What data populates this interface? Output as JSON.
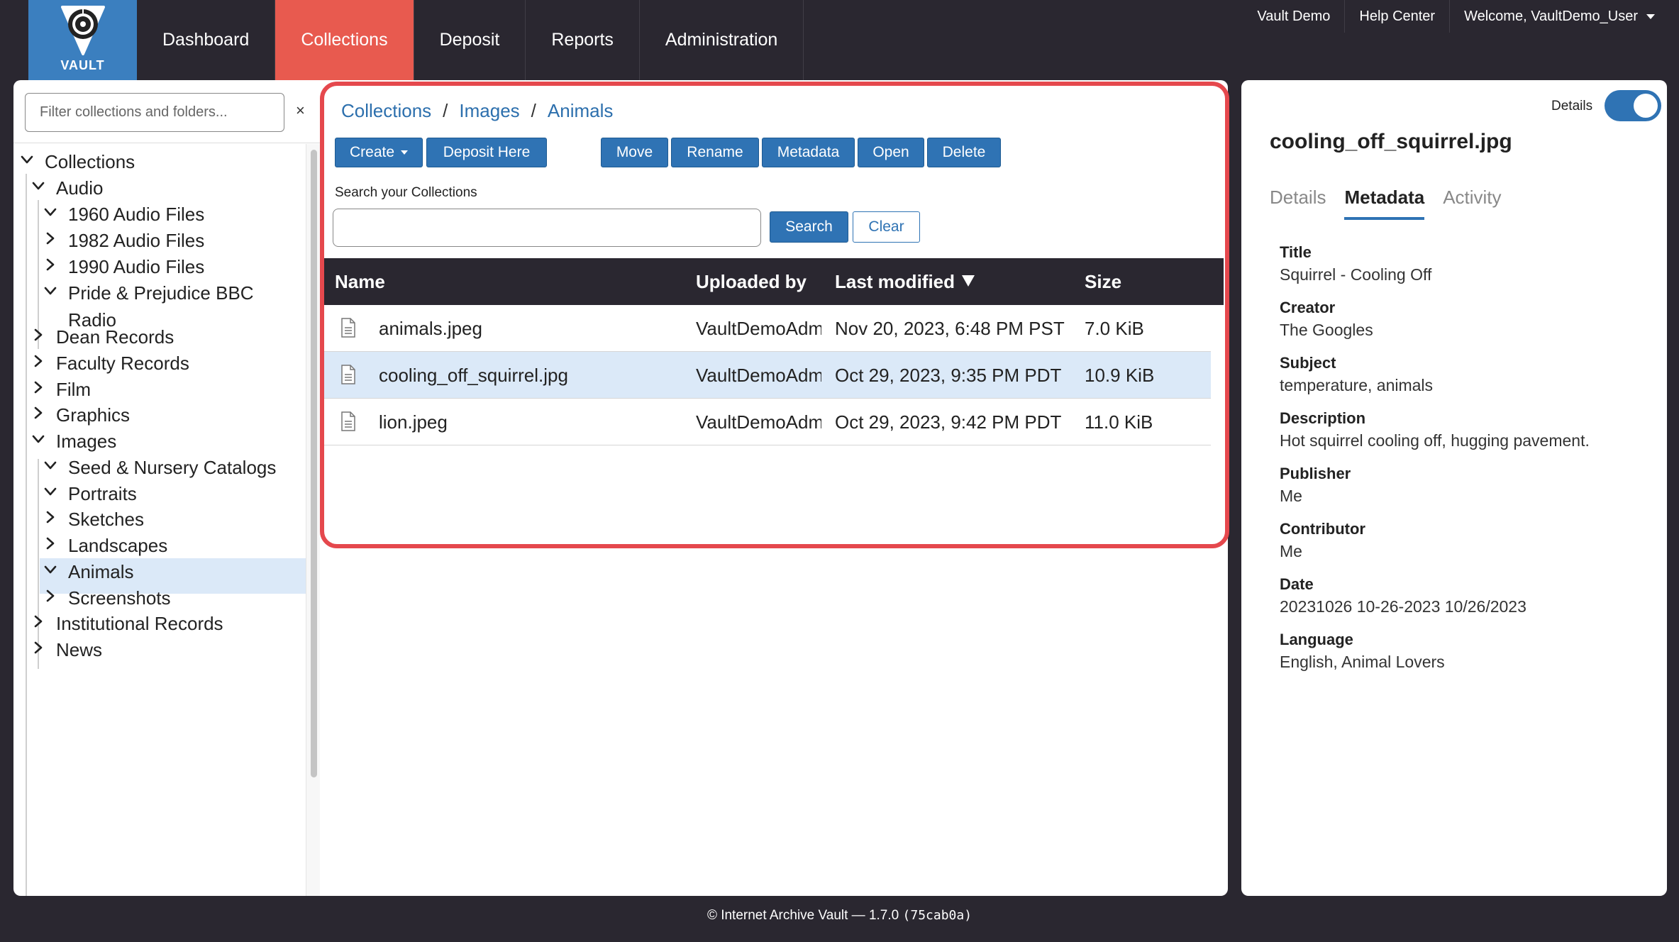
{
  "brand": {
    "logo_text": "VAULT"
  },
  "nav": {
    "items": [
      {
        "label": "Dashboard",
        "active": false
      },
      {
        "label": "Collections",
        "active": true
      },
      {
        "label": "Deposit",
        "active": false
      },
      {
        "label": "Reports",
        "active": false
      },
      {
        "label": "Administration",
        "active": false
      }
    ]
  },
  "utility": {
    "vault_demo": "Vault Demo",
    "help_center": "Help Center",
    "welcome": "Welcome, VaultDemo_User"
  },
  "sidebar": {
    "filter_placeholder": "Filter collections and folders...",
    "filter_clear": "×",
    "tree": [
      {
        "label": "Collections",
        "expanded": true
      },
      {
        "label": "Audio",
        "expanded": true
      },
      {
        "label": "1960 Audio Files",
        "expanded": true
      },
      {
        "label": "1982 Audio Files",
        "expanded": false
      },
      {
        "label": "1990 Audio Files",
        "expanded": false
      },
      {
        "label": "Pride & Prejudice BBC",
        "label2": "Radio",
        "expanded": true
      },
      {
        "label": "Dean Records",
        "expanded": false
      },
      {
        "label": "Faculty Records",
        "expanded": false
      },
      {
        "label": "Film",
        "expanded": false
      },
      {
        "label": "Graphics",
        "expanded": false
      },
      {
        "label": "Images",
        "expanded": true
      },
      {
        "label": "Seed & Nursery Catalogs",
        "expanded": true
      },
      {
        "label": "Portraits",
        "expanded": true
      },
      {
        "label": "Sketches",
        "expanded": false
      },
      {
        "label": "Landscapes",
        "expanded": false
      },
      {
        "label": "Animals",
        "expanded": true,
        "selected": true
      },
      {
        "label": "Screenshots",
        "expanded": false
      },
      {
        "label": "Institutional Records",
        "expanded": false
      },
      {
        "label": "News",
        "expanded": false
      }
    ]
  },
  "breadcrumb": {
    "items": [
      "Collections",
      "Images",
      "Animals"
    ],
    "separator": "/"
  },
  "toolbar": {
    "create": "Create",
    "deposit_here": "Deposit Here",
    "move": "Move",
    "rename": "Rename",
    "metadata": "Metadata",
    "open": "Open",
    "delete": "Delete"
  },
  "search": {
    "label": "Search your Collections",
    "value": "",
    "search_button": "Search",
    "clear_button": "Clear"
  },
  "table": {
    "columns": {
      "name": "Name",
      "uploaded_by": "Uploaded by",
      "last_modified": "Last modified",
      "size": "Size"
    },
    "rows": [
      {
        "name": "animals.jpeg",
        "uploaded_by": "VaultDemoAdmin",
        "last_modified": "Nov 20, 2023, 6:48 PM PST",
        "size": "7.0 KiB"
      },
      {
        "name": "cooling_off_squirrel.jpg",
        "uploaded_by": "VaultDemoAdmin",
        "last_modified": "Oct 29, 2023, 9:35 PM PDT",
        "size": "10.9 KiB"
      },
      {
        "name": "lion.jpeg",
        "uploaded_by": "VaultDemoAdmin",
        "last_modified": "Oct 29, 2023, 9:42 PM PDT",
        "size": "11.0 KiB"
      }
    ]
  },
  "details": {
    "toggle_label": "Details",
    "toggle_on": true,
    "file_title": "cooling_off_squirrel.jpg",
    "tabs": [
      "Details",
      "Metadata",
      "Activity"
    ],
    "active_tab": "Metadata",
    "metadata": [
      {
        "key": "Title",
        "value": "Squirrel - Cooling Off"
      },
      {
        "key": "Creator",
        "value": "The Googles"
      },
      {
        "key": "Subject",
        "value": "temperature, animals"
      },
      {
        "key": "Description",
        "value": "Hot squirrel cooling off, hugging pavement."
      },
      {
        "key": "Publisher",
        "value": "Me"
      },
      {
        "key": "Contributor",
        "value": "Me"
      },
      {
        "key": "Date",
        "value": "20231026 10-26-2023 10/26/2023"
      },
      {
        "key": "Language",
        "value": "English, Animal Lovers"
      }
    ]
  },
  "footer": {
    "text": "© Internet Archive Vault — 1.7.0",
    "hash": "(75cab0a)"
  },
  "colors": {
    "accent": "#2f73b4",
    "active_nav": "#e85a4f",
    "highlight": "#e5484d",
    "background": "#2a2730",
    "selected_row": "#dbe9f8"
  }
}
